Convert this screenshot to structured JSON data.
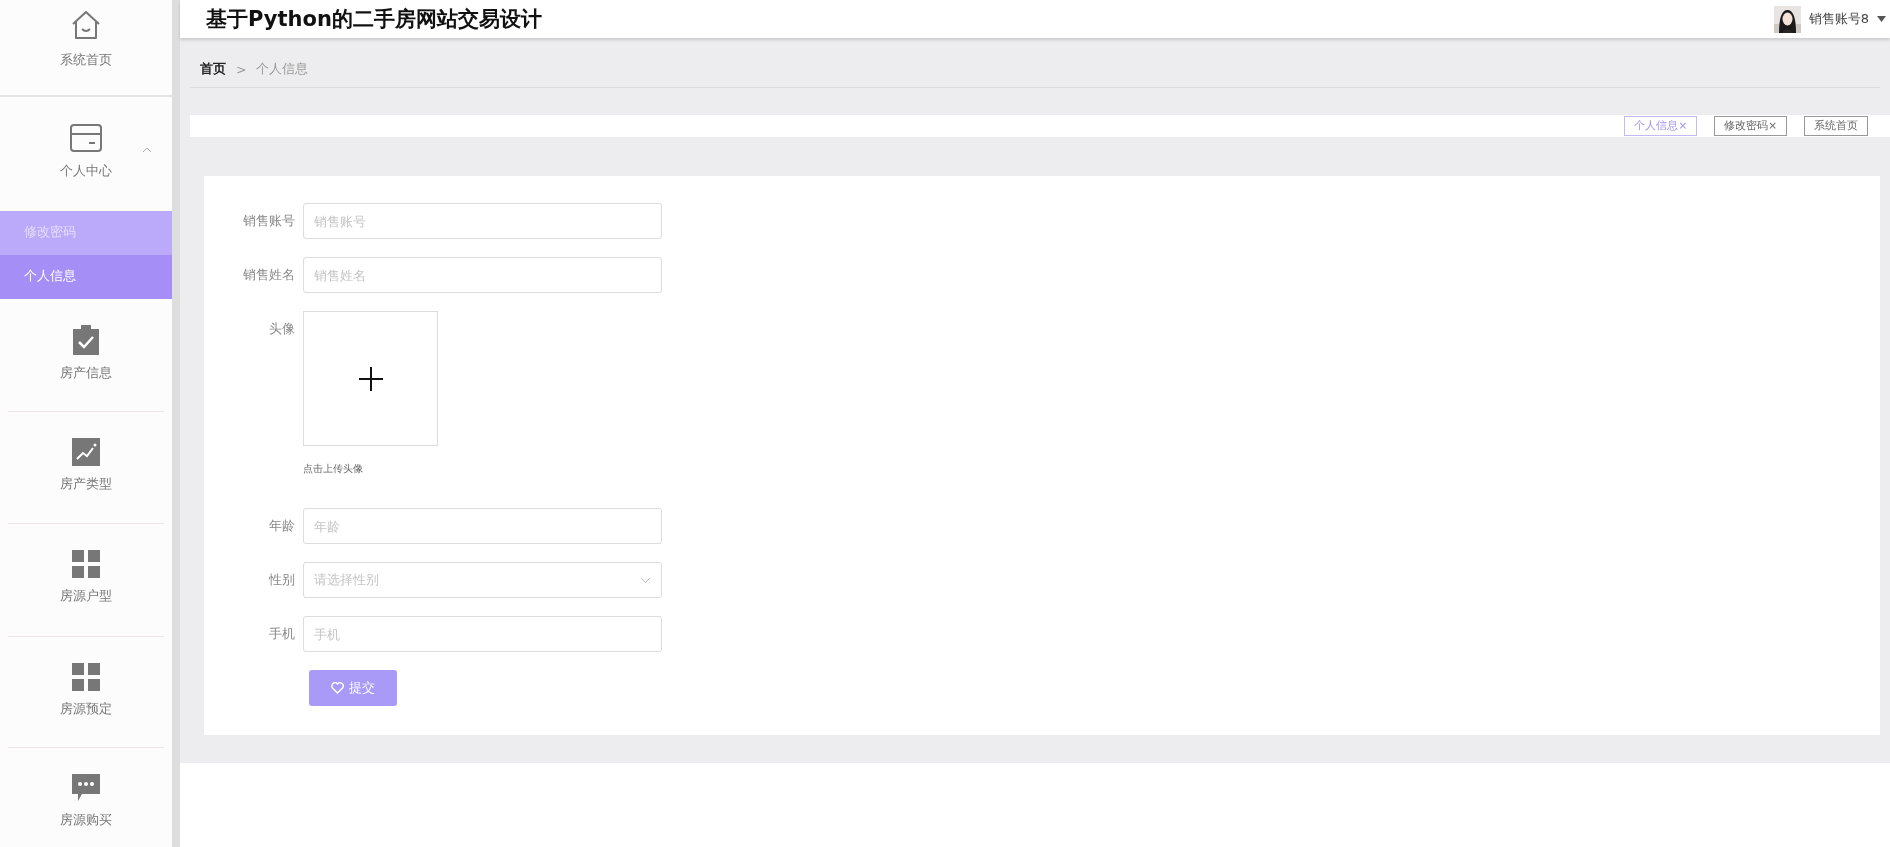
{
  "sidebar": {
    "items": [
      {
        "label": "系统首页"
      },
      {
        "label": "个人中心",
        "expanded": true,
        "children": [
          {
            "label": "修改密码",
            "selected": false
          },
          {
            "label": "个人信息",
            "selected": true
          }
        ]
      },
      {
        "label": "房产信息"
      },
      {
        "label": "房产类型"
      },
      {
        "label": "房源户型"
      },
      {
        "label": "房源预定"
      },
      {
        "label": "房源购买"
      }
    ]
  },
  "header": {
    "title": "基于Python的二手房网站交易设计",
    "user": {
      "name": "销售账号8"
    }
  },
  "breadcrumb": [
    {
      "label": "首页",
      "current": false
    },
    {
      "label": ">",
      "kind": "separator"
    },
    {
      "label": "个人信息",
      "current": true
    }
  ],
  "tags": [
    {
      "label": "个人信息",
      "close": "×",
      "selected": true
    },
    {
      "label": "修改密码",
      "close": "×",
      "selected": false
    },
    {
      "label": "系统首页",
      "selected": false
    }
  ],
  "form": {
    "fields": [
      {
        "kind": "input",
        "label": "销售账号",
        "placeholder": "销售账号"
      },
      {
        "kind": "input",
        "label": "销售姓名",
        "placeholder": "销售姓名"
      },
      {
        "kind": "upload",
        "label": "头像",
        "hint": "点击上传头像"
      },
      {
        "kind": "input",
        "label": "年龄",
        "placeholder": "年龄"
      },
      {
        "kind": "select",
        "label": "性别",
        "placeholder": "请选择性别"
      },
      {
        "kind": "input",
        "label": "手机",
        "placeholder": "手机"
      }
    ],
    "submit": "提交"
  }
}
